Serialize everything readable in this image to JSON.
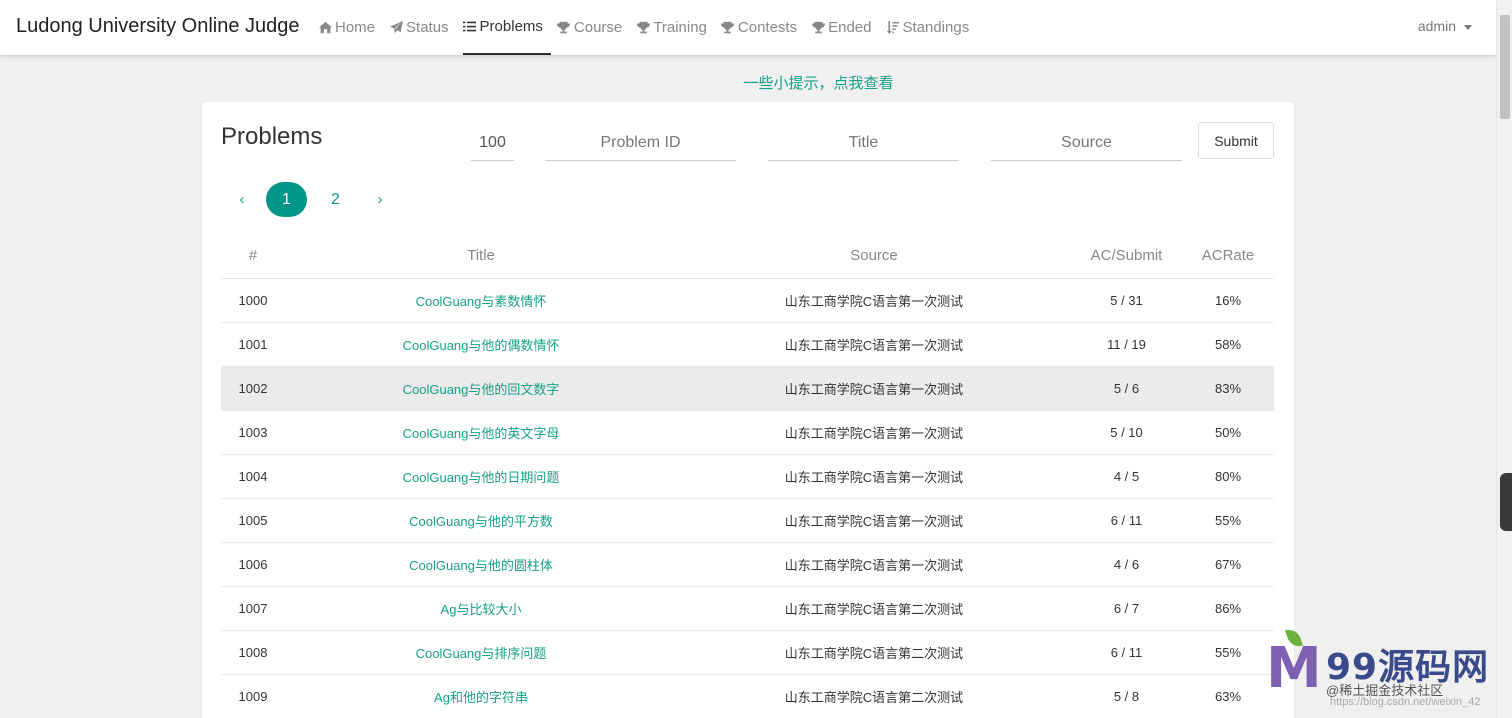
{
  "header": {
    "brand": "Ludong University Online Judge",
    "nav": [
      {
        "label": "Home",
        "icon": "home-icon"
      },
      {
        "label": "Status",
        "icon": "send-icon"
      },
      {
        "label": "Problems",
        "icon": "list-icon",
        "active": true
      },
      {
        "label": "Course",
        "icon": "trophy-icon"
      },
      {
        "label": "Training",
        "icon": "trophy-icon"
      },
      {
        "label": "Contests",
        "icon": "trophy-icon"
      },
      {
        "label": "Ended",
        "icon": "trophy-icon"
      },
      {
        "label": "Standings",
        "icon": "sort-icon"
      }
    ],
    "user": "admin"
  },
  "tip": "一些小提示，点我查看",
  "panel": {
    "title": "Problems",
    "filters": {
      "limit_value": "100",
      "problem_id_placeholder": "Problem ID",
      "title_placeholder": "Title",
      "source_placeholder": "Source"
    },
    "submit_label": "Submit",
    "pagination": {
      "prev": "‹",
      "next": "›",
      "pages": [
        "1",
        "2"
      ],
      "current": "1"
    },
    "table": {
      "columns": [
        "#",
        "Title",
        "Source",
        "AC/Submit",
        "ACRate"
      ],
      "rows": [
        {
          "id": "1000",
          "title": "CoolGuang与素数情怀",
          "source": "山东工商学院C语言第一次测试",
          "ac_submit": "5 / 31",
          "rate": "16%"
        },
        {
          "id": "1001",
          "title": "CoolGuang与他的偶数情怀",
          "source": "山东工商学院C语言第一次测试",
          "ac_submit": "11 / 19",
          "rate": "58%"
        },
        {
          "id": "1002",
          "title": "CoolGuang与他的回文数字",
          "source": "山东工商学院C语言第一次测试",
          "ac_submit": "5 / 6",
          "rate": "83%"
        },
        {
          "id": "1003",
          "title": "CoolGuang与他的英文字母",
          "source": "山东工商学院C语言第一次测试",
          "ac_submit": "5 / 10",
          "rate": "50%"
        },
        {
          "id": "1004",
          "title": "CoolGuang与他的日期问题",
          "source": "山东工商学院C语言第一次测试",
          "ac_submit": "4 / 5",
          "rate": "80%"
        },
        {
          "id": "1005",
          "title": "CoolGuang与他的平方数",
          "source": "山东工商学院C语言第一次测试",
          "ac_submit": "6 / 11",
          "rate": "55%"
        },
        {
          "id": "1006",
          "title": "CoolGuang与他的圆柱体",
          "source": "山东工商学院C语言第一次测试",
          "ac_submit": "4 / 6",
          "rate": "67%"
        },
        {
          "id": "1007",
          "title": "Ag与比较大小",
          "source": "山东工商学院C语言第二次测试",
          "ac_submit": "6 / 7",
          "rate": "86%"
        },
        {
          "id": "1008",
          "title": "CoolGuang与排序问题",
          "source": "山东工商学院C语言第二次测试",
          "ac_submit": "6 / 11",
          "rate": "55%"
        },
        {
          "id": "1009",
          "title": "Ag和他的字符串",
          "source": "山东工商学院C语言第二次测试",
          "ac_submit": "5 / 8",
          "rate": "63%"
        }
      ]
    }
  },
  "watermark": {
    "logo_letter": "M",
    "title": "99源码网",
    "subtitle": "@稀土掘金技术社区",
    "url": "https://blog.csdn.net/weixin_42"
  },
  "colors": {
    "accent": "#16a085",
    "active_page": "#009688",
    "brand_text": "#222222"
  }
}
